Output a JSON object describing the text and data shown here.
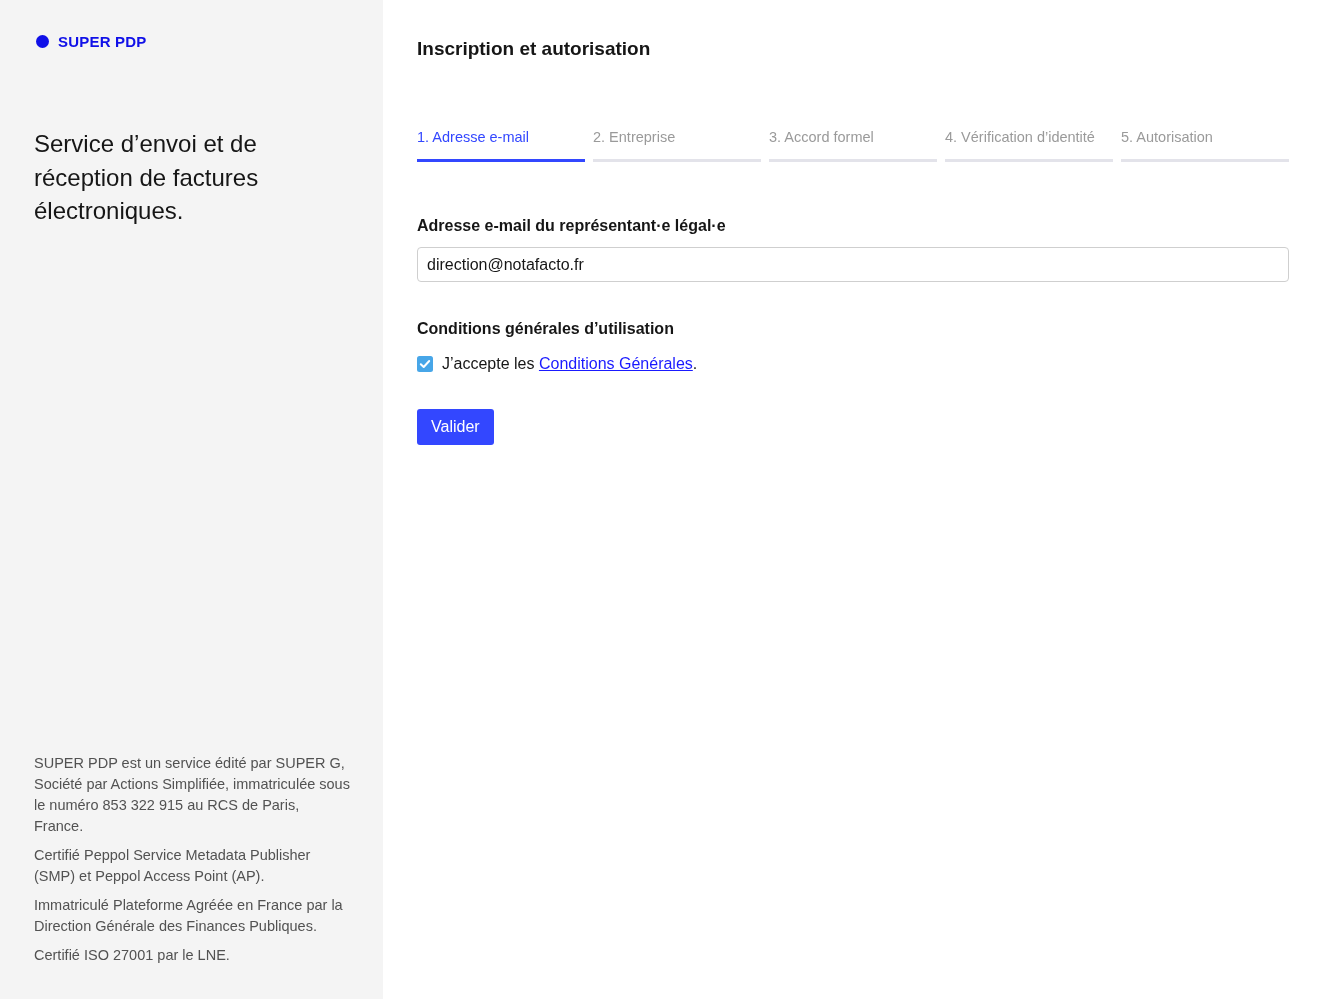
{
  "sidebar": {
    "logo": "SUPER PDP",
    "tagline": "Service d’envoi et de réception de factures électroniques.",
    "legal_notes": [
      "SUPER PDP est un service édité par SUPER G, Société par Actions Simplifiée, immatriculée sous le numéro 853 322 915 au RCS de Paris, France.",
      "Certifié Peppol Service Metadata Publisher (SMP) et Peppol Access Point (AP).",
      "Immatriculé Plateforme Agréée en France par la Direction Générale des Finances Publiques.",
      "Certifié ISO 27001 par le LNE."
    ]
  },
  "main": {
    "title": "Inscription et autorisation",
    "steps": [
      {
        "label": "1. Adresse e-mail",
        "selected": true
      },
      {
        "label": "2. Entreprise",
        "selected": false
      },
      {
        "label": "3. Accord formel",
        "selected": false
      },
      {
        "label": "4. Vérification d’identité",
        "selected": false
      },
      {
        "label": "5. Autorisation",
        "selected": false
      }
    ],
    "email_field": {
      "label": "Adresse e-mail du représentant·e légal·e",
      "value": "direction@notafacto.fr"
    },
    "terms": {
      "heading": "Conditions générales d’utilisation",
      "checked": true,
      "text": "J’accepte les ",
      "link": "Conditions Générales",
      "suffix": "."
    },
    "submit_button": "Valider"
  }
}
